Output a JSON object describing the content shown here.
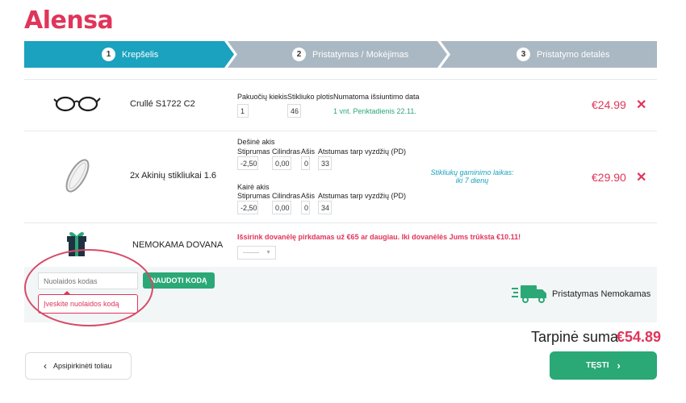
{
  "brand": {
    "logo_text": "Alensa",
    "accent": "#e0355a",
    "teal": "#1aa2be",
    "green": "#2aa876"
  },
  "steps": [
    {
      "num": "1",
      "label": "Krepšelis",
      "active": true
    },
    {
      "num": "2",
      "label": "Pristatymas / Mokėjimas",
      "active": false
    },
    {
      "num": "3",
      "label": "Pristatymo detalės",
      "active": false
    }
  ],
  "items": [
    {
      "name": "Crullé S1722 C2",
      "image_icon": "glasses-icon",
      "headers": {
        "pack_qty": "Pakuočių kiekis",
        "lens_width": "Stikliuko plotis",
        "ship_date": "Numatoma išsiuntimo data"
      },
      "pack_qty": "1",
      "lens_width": "46",
      "ship_info": "1 vnt. Penktadienis 22.11.",
      "price": "€24.99"
    },
    {
      "name": "2x Akinių stikliukai 1.6",
      "image_icon": "lens-icon",
      "right_eye": {
        "title": "Dešinė akis",
        "headers": [
          "Stiprumas",
          "Cilindras",
          "Ašis",
          "Atstumas tarp vyzdžių (PD)"
        ],
        "values": [
          "-2,50",
          "0,00",
          "0",
          "33"
        ]
      },
      "left_eye": {
        "title": "Kairė akis",
        "headers": [
          "Stiprumas",
          "Cilindras",
          "Ašis",
          "Atstumas tarp vyzdžių (PD)"
        ],
        "values": [
          "-2,50",
          "0,00",
          "0",
          "34"
        ]
      },
      "production_note": "Stikliukų gaminimo laikas: iki 7 dienų",
      "price": "€29.90"
    }
  ],
  "gift": {
    "name": "NEMOKAMA DOVANA",
    "icon": "gift-icon",
    "message": "Išsirink dovanėlę pirkdamas už €65 ar daugiau. Iki dovanėlės Jums trūksta €10.11!"
  },
  "coupon": {
    "placeholder": "Nuolaidos kodas",
    "button_label": "NAUDOTI KODĄ",
    "error": "Įveskite nuolaidos kodą"
  },
  "delivery": {
    "label": "Pristatymas Nemokamas",
    "icon": "truck-icon"
  },
  "summary": {
    "label": "Tarpinė suma",
    "value": "€54.89"
  },
  "actions": {
    "back_label": "Apsipirkinėti toliau",
    "next_label": "TĘSTI"
  }
}
